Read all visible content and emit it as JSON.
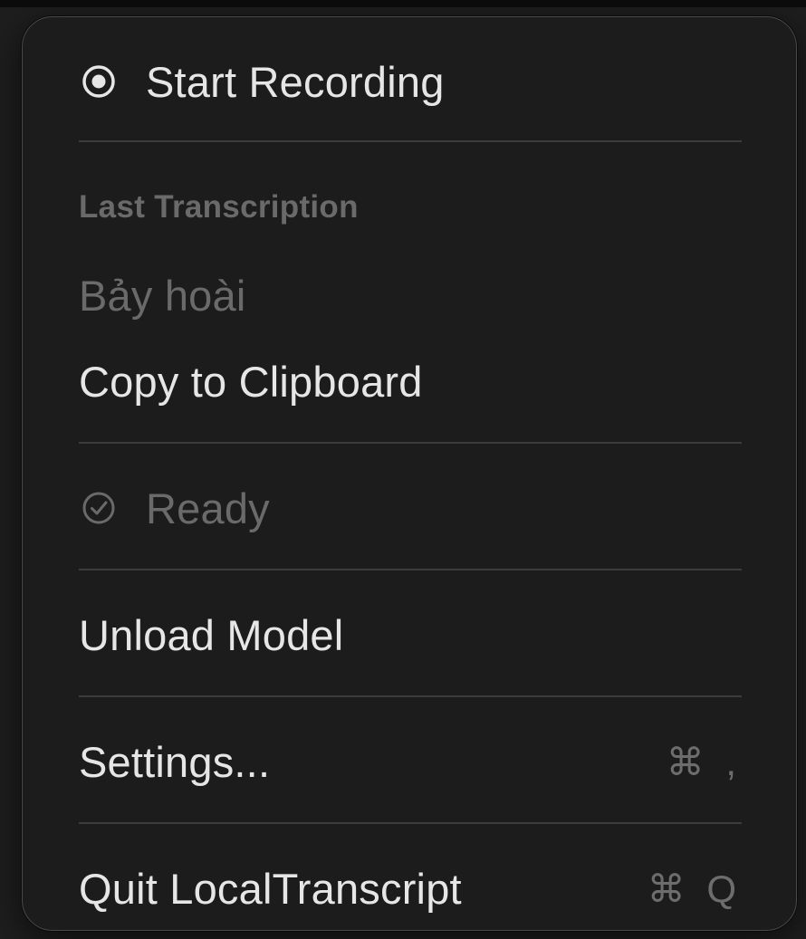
{
  "menu": {
    "start_recording": {
      "label": "Start Recording",
      "icon": "record-icon"
    },
    "last_transcription_header": "Last Transcription",
    "last_transcription_text": "Bảy hoài",
    "copy_to_clipboard": "Copy to Clipboard",
    "status": {
      "label": "Ready",
      "icon": "checkmark-circle-icon"
    },
    "unload_model": "Unload Model",
    "settings": {
      "label": "Settings...",
      "shortcut": "⌘ ,"
    },
    "quit": {
      "label": "Quit LocalTranscript",
      "shortcut": "⌘ Q"
    }
  },
  "colors": {
    "menu_background": "#1c1c1c",
    "text_primary": "#e6e6e6",
    "text_disabled": "#6a6a6a",
    "separator": "#3c3c3c"
  }
}
